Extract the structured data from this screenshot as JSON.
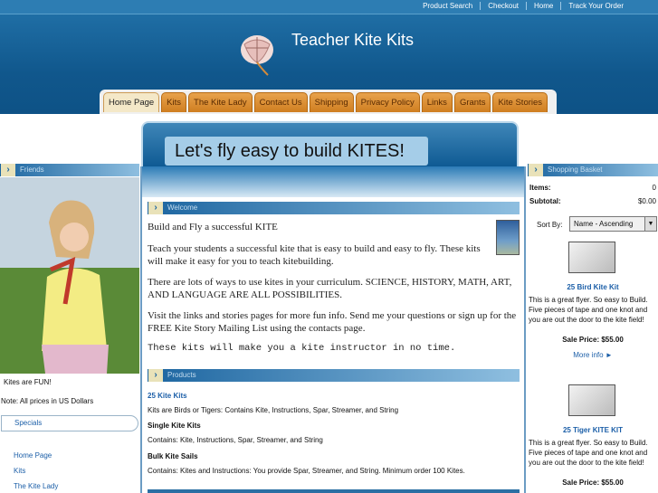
{
  "top_nav": [
    "Product Search",
    "Checkout",
    "Home",
    "Track Your Order"
  ],
  "site_title": "Teacher Kite Kits",
  "tabs": [
    "Home Page",
    "Kits",
    "The Kite Lady",
    "Contact Us",
    "Shipping",
    "Privacy Policy",
    "Links",
    "Grants",
    "Kite Stories"
  ],
  "banner_text": "Let's fly easy to build KITES!",
  "left": {
    "section_label": "Friends",
    "caption": "Kites are FUN!",
    "note": "Note: All prices in US Dollars",
    "specials_label": "Specials",
    "nav": [
      "Home Page",
      "Kits",
      "The Kite Lady"
    ]
  },
  "center": {
    "welcome_label": "Welcome",
    "paragraphs": [
      "Build and Fly a successful KITE",
      "Teach your students a successful kite that is easy to build and easy to fly.  These kits will make it easy for you to teach kitebuilding.",
      "There are lots of ways to use kites in your curriculum.  SCIENCE, HISTORY, MATH, ART, AND LANGUAGE ARE ALL POSSIBILITIES.",
      "Visit the links and stories pages for more fun info.  Send me your questions or sign up for the FREE Kite Story Mailing List using the contacts page."
    ],
    "mono_line": "These kits will make you a kite instructor in no time.",
    "products_label": "Products",
    "product_link": "25 Kite Kits",
    "product_link_desc": "Kits are Birds or Tigers: Contains Kite, Instructions, Spar, Streamer, and String",
    "product_2_title": "Single Kite Kits",
    "product_2_desc": "Contains: Kite, Instructions, Spar, Streamer, and String",
    "product_3_title": "Bulk Kite Sails",
    "product_3_desc": "Contains: Kites and Instructions: You provide Spar, Streamer, and String. Minimum order 100 Kites."
  },
  "right": {
    "section_label": "Shopping Basket",
    "items_label": "Items:",
    "items_value": "0",
    "subtotal_label": "Subtotal:",
    "subtotal_value": "$0.00",
    "sort_label": "Sort By:",
    "sort_value": "Name - Ascending",
    "products": [
      {
        "name": "25 Bird Kite Kit",
        "desc": "This is a great flyer. So easy to Build. Five pieces of tape and one knot and you are out the door to the kite field!",
        "price": "Sale Price: $55.00",
        "more": "More info ►"
      },
      {
        "name": "25 Tiger KITE KIT",
        "desc": "This is a great flyer. So easy to Build. Five pieces of tape and one knot and you are out the door to the kite field!",
        "price": "Sale Price: $55.00"
      }
    ]
  }
}
